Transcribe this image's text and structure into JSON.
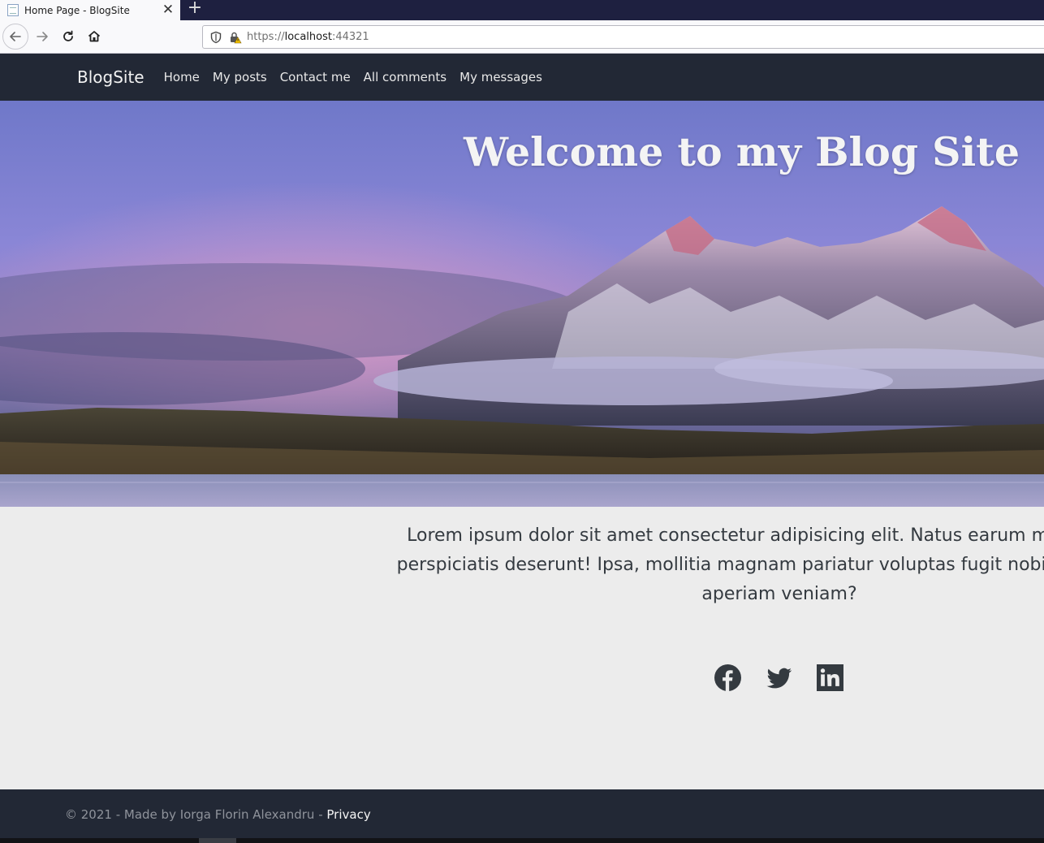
{
  "browser": {
    "tab_title": "Home Page - BlogSite",
    "tab_close": "✕",
    "new_tab": "+",
    "url_scheme": "https://",
    "url_host": "localhost",
    "url_port": ":44321"
  },
  "site_nav": {
    "brand": "BlogSite",
    "links": [
      "Home",
      "My posts",
      "Contact me",
      "All comments",
      "My messages"
    ]
  },
  "hero": {
    "title": "Welcome to my Blog Site"
  },
  "content": {
    "paragraph_lines": [
      "Lorem ipsum dolor sit amet consectetur adipisicing elit. Natus earum molestias ver",
      "perspiciatis deserunt! Ipsa, mollitia magnam pariatur voluptas fugit nobis provident c",
      "aperiam veniam?"
    ],
    "social_icons": [
      "facebook-icon",
      "twitter-icon",
      "linkedin-icon"
    ]
  },
  "footer": {
    "copyright": "© 2021 - Made by Iorga Florin Alexandru - ",
    "privacy_label": "Privacy"
  },
  "colors": {
    "navbar_bg": "#222835",
    "content_bg": "#ececec",
    "text_dark": "#343a40"
  }
}
